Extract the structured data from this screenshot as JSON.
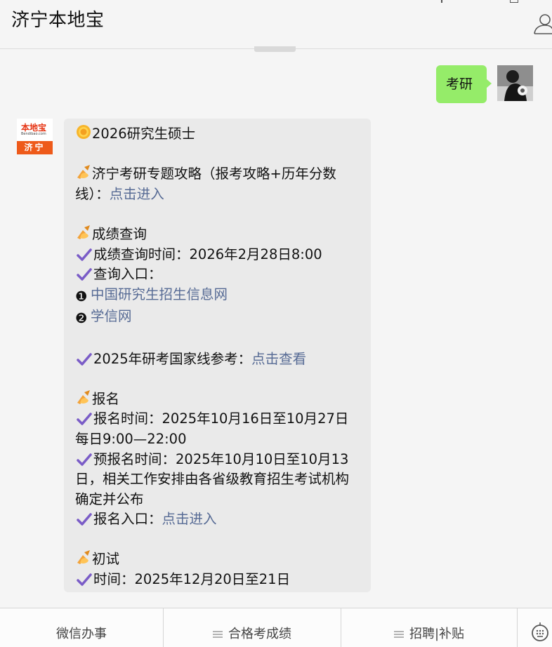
{
  "app": {
    "title": "济宁本地宝"
  },
  "icons": {
    "user": "user-icon",
    "sun": "sun-emoji",
    "writing_hand": "writing-hand-emoji",
    "check": "heavy-check-mark",
    "keyboard": "keyboard-icon",
    "menu": "menu-lines-icon"
  },
  "colors": {
    "my_bubble": "#95ec69",
    "bot_bubble": "#eaeaea",
    "link": "#576b95",
    "check": "#7a5cc7",
    "avatar_brand": "#ee5a1a"
  },
  "chat": {
    "user_message": "考研",
    "bot_avatar": {
      "logo_text": "本地宝",
      "logo_url": "Bendibao.com",
      "city": "济宁"
    },
    "bot_message": {
      "l01": "2026研究生硕士",
      "l02_text": "济宁考研专题攻略（报考攻略+历年分数线）：",
      "l02_link": "点击进入",
      "l03": "成绩查询",
      "l04": "成绩查询时间：2026年2月28日8:00",
      "l05": "查询入口：",
      "l06_num": "❶",
      "l06_link": "中国研究生招生信息网",
      "l07_num": "❷",
      "l07_link": "学信网",
      "l08_text": "2025年研考国家线参考：",
      "l08_link": "点击查看",
      "l09": "报名",
      "l10": "报名时间：2025年10月16日至10月27日每日9:00—22:00",
      "l11": "预报名时间：2025年10月10日至10月13日，相关工作安排由各省级教育招生考试机构确定并公布",
      "l12_text": "报名入口：",
      "l12_link": "点击进入",
      "l13": "初试",
      "l14": "时间：2025年12月20日至21日"
    }
  },
  "footer": {
    "tabs": [
      {
        "label": "微信办事"
      },
      {
        "label": "合格考成绩"
      },
      {
        "label": "招聘|补贴"
      }
    ]
  }
}
